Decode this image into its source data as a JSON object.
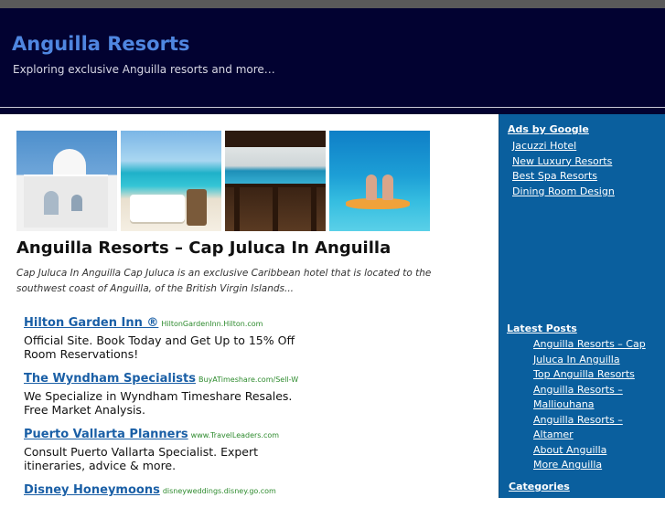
{
  "header": {
    "title": "Anguilla Resorts",
    "description": "Exploring exclusive Anguilla resorts and more…"
  },
  "post": {
    "title": "Anguilla Resorts – Cap Juluca In Anguilla",
    "excerpt": "Cap Juluca In Anguilla Cap Juluca is an exclusive Caribbean hotel that is located to the southwest coast of Anguilla, of the British Virgin Islands..."
  },
  "ads": [
    {
      "title": "Hilton Garden Inn ®",
      "url": "HiltonGardenInn.Hilton.com",
      "body": "Official Site. Book Today and Get Up to 15% Off Room Reservations!"
    },
    {
      "title": "The Wyndham Specialists",
      "url": "BuyATimeshare.com/Sell-W…",
      "body": "We Specialize in Wyndham Timeshare Resales. Free Market Analysis."
    },
    {
      "title": "Puerto Vallarta Planners",
      "url": "www.TravelLeaders.com",
      "body": "Consult Puerto Vallarta Specialist. Expert itineraries, advice & more."
    },
    {
      "title": "Disney Honeymoons",
      "url": "disneyweddings.disney.go.com",
      "body": ""
    }
  ],
  "sidebar": {
    "ads_heading": "Ads by Google",
    "ads_links": [
      "Jacuzzi Hotel",
      "New Luxury Resorts",
      "Best Spa Resorts",
      "Dining Room Design"
    ],
    "latest_heading": "Latest Posts",
    "latest_posts": [
      "Anguilla Resorts – Cap Juluca In Anguilla",
      "Top Anguilla Resorts",
      "Anguilla Resorts – Malliouhana",
      "Anguilla Resorts – Altamer",
      "About Anguilla",
      "More Anguilla"
    ],
    "categories_heading": "Categories"
  },
  "colors": {
    "header_bg": "#020231",
    "title_blue": "#4f86e0",
    "sidebar_bg": "#0a5f9e",
    "ad_link": "#1a5fa6",
    "ad_url": "#2e8b2e"
  }
}
